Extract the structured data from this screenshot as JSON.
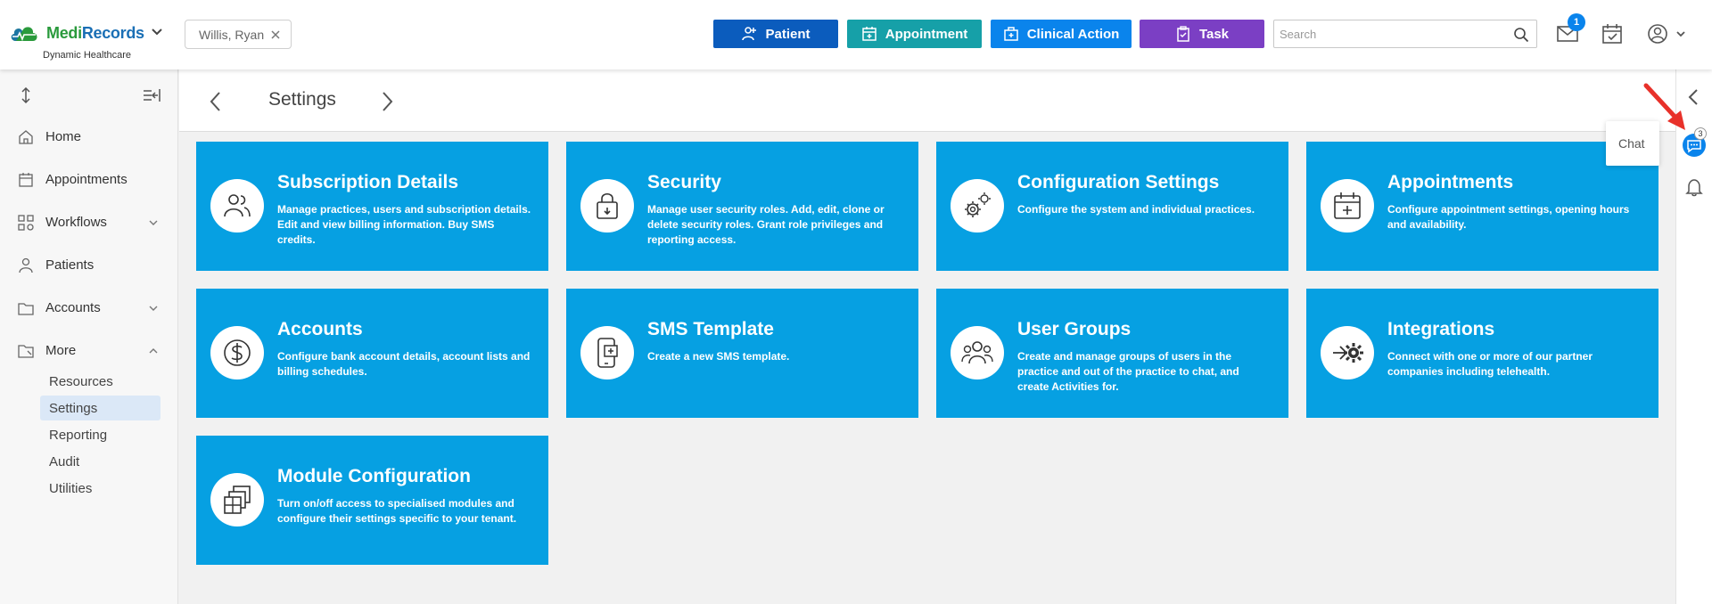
{
  "brand": {
    "name_part1": "Medi",
    "name_part2": "Records",
    "subtitle": "Dynamic Healthcare"
  },
  "header": {
    "patient_chip": "Willis, Ryan",
    "buttons": {
      "patient": "Patient",
      "appointment": "Appointment",
      "clinical_action": "Clinical Action",
      "task": "Task"
    },
    "search_placeholder": "Search",
    "mail_badge": "1"
  },
  "sidebar": {
    "items": [
      {
        "label": "Home",
        "icon": "home-icon"
      },
      {
        "label": "Appointments",
        "icon": "calendar-icon"
      },
      {
        "label": "Workflows",
        "icon": "workflow-icon"
      },
      {
        "label": "Patients",
        "icon": "patients-icon"
      },
      {
        "label": "Accounts",
        "icon": "accounts-icon"
      },
      {
        "label": "More",
        "icon": "folder-icon"
      }
    ],
    "more_sub": [
      "Resources",
      "Settings",
      "Reporting",
      "Audit",
      "Utilities"
    ]
  },
  "page": {
    "title": "Settings"
  },
  "cards": [
    {
      "title": "Subscription Details",
      "desc": "Manage practices, users and subscription details. Edit and view billing information. Buy SMS credits.",
      "icon": "users-icon"
    },
    {
      "title": "Security",
      "desc": "Manage user security roles. Add, edit, clone or delete security roles. Grant role privileges and reporting access.",
      "icon": "lock-icon"
    },
    {
      "title": "Configuration Settings",
      "desc": "Configure the system and individual practices.",
      "icon": "gears-icon"
    },
    {
      "title": "Appointments",
      "desc": "Configure appointment settings, opening hours and availability.",
      "icon": "calendar-plus-icon"
    },
    {
      "title": "Accounts",
      "desc": "Configure bank account details, account lists and billing schedules.",
      "icon": "dollar-icon"
    },
    {
      "title": "SMS Template",
      "desc": "Create a new SMS template.",
      "icon": "phone-template-icon"
    },
    {
      "title": "User Groups",
      "desc": "Create and manage groups of users in the practice and out of the practice to chat, and create Activities for.",
      "icon": "user-group-icon"
    },
    {
      "title": "Integrations",
      "desc": "Connect with one or more of our partner companies including telehealth.",
      "icon": "integration-icon"
    },
    {
      "title": "Module Configuration",
      "desc": "Turn on/off access to specialised modules and configure their settings specific to your tenant.",
      "icon": "modules-icon"
    }
  ],
  "rail": {
    "chat_label": "Chat",
    "chat_count": "3"
  },
  "colors": {
    "card": "#06a0e2",
    "patient_btn": "#0b5cbd",
    "appointment_btn": "#16a0a8",
    "clinical_btn": "#0a84ec",
    "task_btn": "#7b3fc4"
  }
}
